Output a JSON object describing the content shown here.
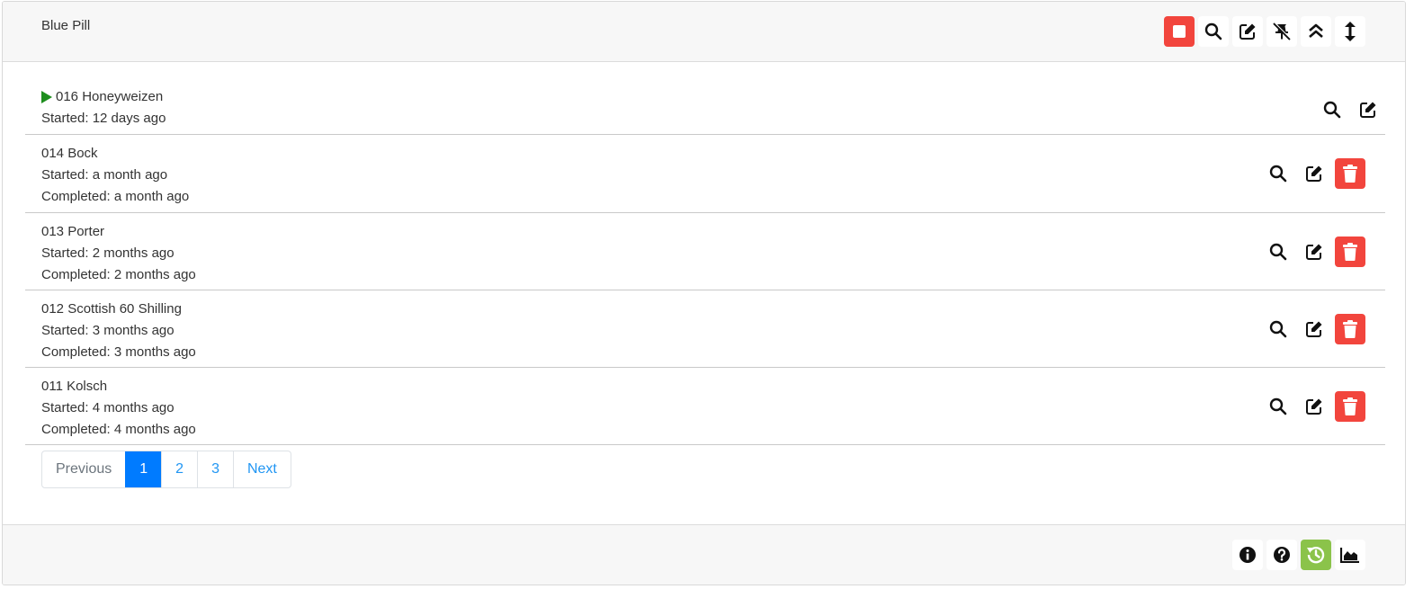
{
  "header": {
    "title": "Blue Pill",
    "toolbar": [
      {
        "name": "stop-button",
        "icon": "stop-icon",
        "color": "#f2453d"
      },
      {
        "name": "search-button",
        "icon": "search-icon"
      },
      {
        "name": "edit-button",
        "icon": "edit-icon"
      },
      {
        "name": "unpin-button",
        "icon": "unpin-icon"
      },
      {
        "name": "collapse-button",
        "icon": "chevron-double-up-icon"
      },
      {
        "name": "expand-button",
        "icon": "arrows-vertical-icon"
      }
    ]
  },
  "brews": [
    {
      "name": "016 Honeyweizen",
      "started": "Started: 12 days ago",
      "completed": "",
      "active": true
    },
    {
      "name": "014 Bock",
      "started": "Started: a month ago",
      "completed": "Completed: a month ago",
      "active": false
    },
    {
      "name": "013 Porter",
      "started": "Started: 2 months ago",
      "completed": "Completed: 2 months ago",
      "active": false
    },
    {
      "name": "012 Scottish 60 Shilling",
      "started": "Started: 3 months ago",
      "completed": "Completed: 3 months ago",
      "active": false
    },
    {
      "name": "011 Kolsch",
      "started": "Started: 4 months ago",
      "completed": "Completed: 4 months ago",
      "active": false
    }
  ],
  "pagination": {
    "previous": "Previous",
    "pages": [
      "1",
      "2",
      "3"
    ],
    "active_page": "1",
    "next": "Next"
  },
  "footer": {
    "toolbar": [
      {
        "name": "info-button",
        "icon": "info-icon"
      },
      {
        "name": "help-button",
        "icon": "question-icon"
      },
      {
        "name": "history-button",
        "icon": "history-icon",
        "color": "#8bc34a"
      },
      {
        "name": "chart-button",
        "icon": "area-chart-icon"
      }
    ]
  },
  "colors": {
    "danger": "#f2453d",
    "success": "#8bc34a",
    "primary": "#007bff",
    "link": "#2196f3",
    "play": "#1e8e1e"
  }
}
